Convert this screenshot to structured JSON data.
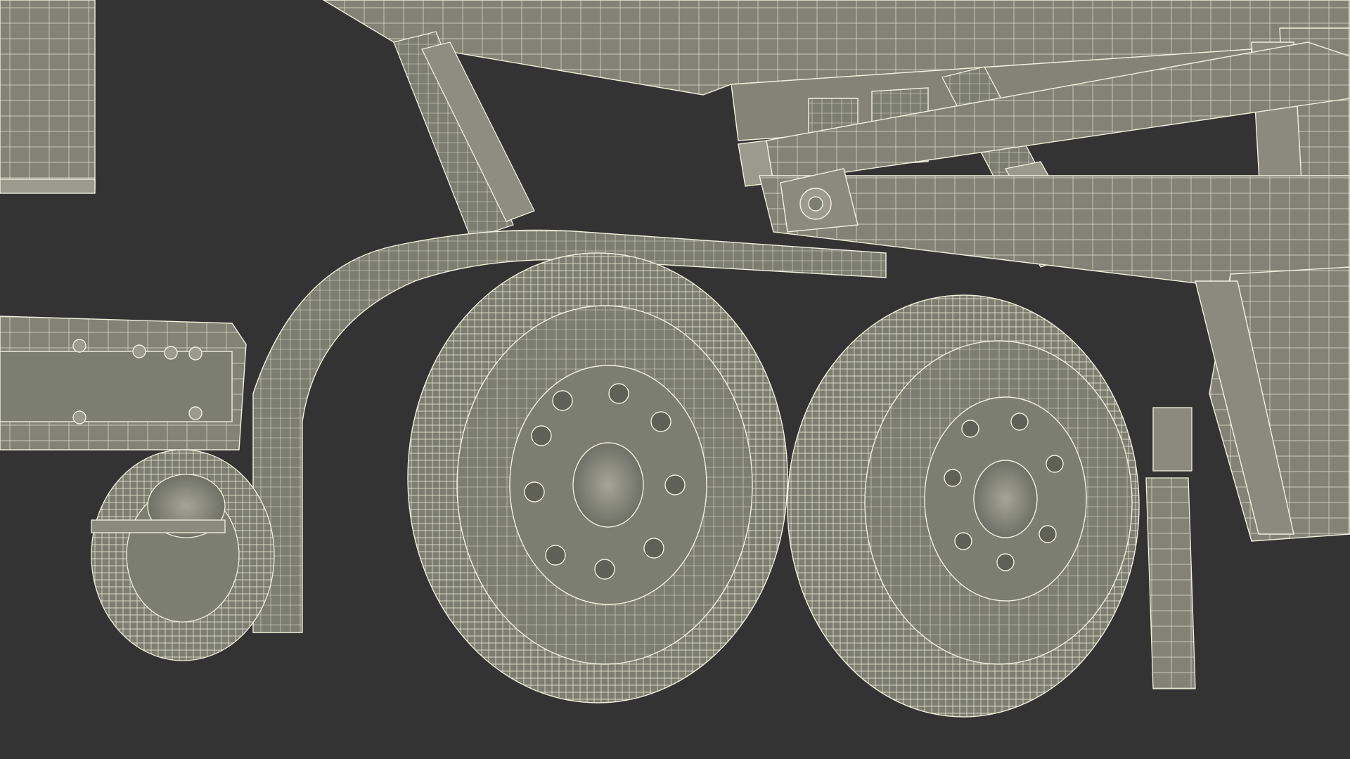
{
  "render": {
    "subject": "wireframe-truck-chassis-rear-axles",
    "background_color": "#333333",
    "surface_color": "#7d7e72",
    "surface_light": "#9a9b8d",
    "surface_dark": "#5f6056",
    "wire_color": "#f2f0dd",
    "shadow_color": "#2b2b28"
  }
}
